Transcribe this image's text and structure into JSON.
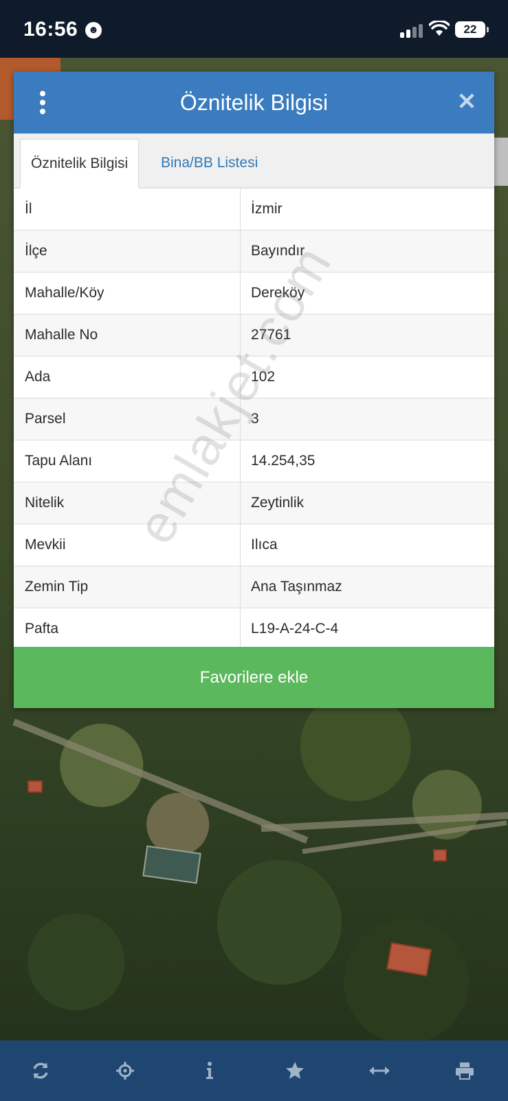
{
  "status_bar": {
    "time": "16:56",
    "battery": "22"
  },
  "dialog": {
    "title": "Öznitelik Bilgisi",
    "menu_icon": "kebab-menu-icon",
    "close_icon": "close-icon",
    "tabs": [
      {
        "label": "Öznitelik Bilgisi",
        "active": true
      },
      {
        "label": "Bina/BB Listesi",
        "active": false
      }
    ],
    "rows": [
      {
        "label": "İl",
        "value": "İzmir"
      },
      {
        "label": "İlçe",
        "value": "Bayındır"
      },
      {
        "label": "Mahalle/Köy",
        "value": "Dereköy"
      },
      {
        "label": "Mahalle No",
        "value": "27761"
      },
      {
        "label": "Ada",
        "value": "102"
      },
      {
        "label": "Parsel",
        "value": "3"
      },
      {
        "label": "Tapu Alanı",
        "value": "14.254,35"
      },
      {
        "label": "Nitelik",
        "value": "Zeytinlik"
      },
      {
        "label": "Mevkii",
        "value": "Ilıca"
      },
      {
        "label": "Zemin Tip",
        "value": "Ana Taşınmaz"
      },
      {
        "label": "Pafta",
        "value": "L19-A-24-C-4"
      }
    ],
    "favorite_button": "Favorilere ekle"
  },
  "watermark": "emlakjet.com",
  "toolbar": {
    "icons": [
      "refresh-icon",
      "locate-icon",
      "info-icon",
      "star-icon",
      "measure-icon",
      "print-icon"
    ]
  },
  "colors": {
    "header": "#3b7bbf",
    "favorite": "#5cb85c",
    "toolbar": "#1e4670",
    "tab_link": "#2f79b7"
  }
}
